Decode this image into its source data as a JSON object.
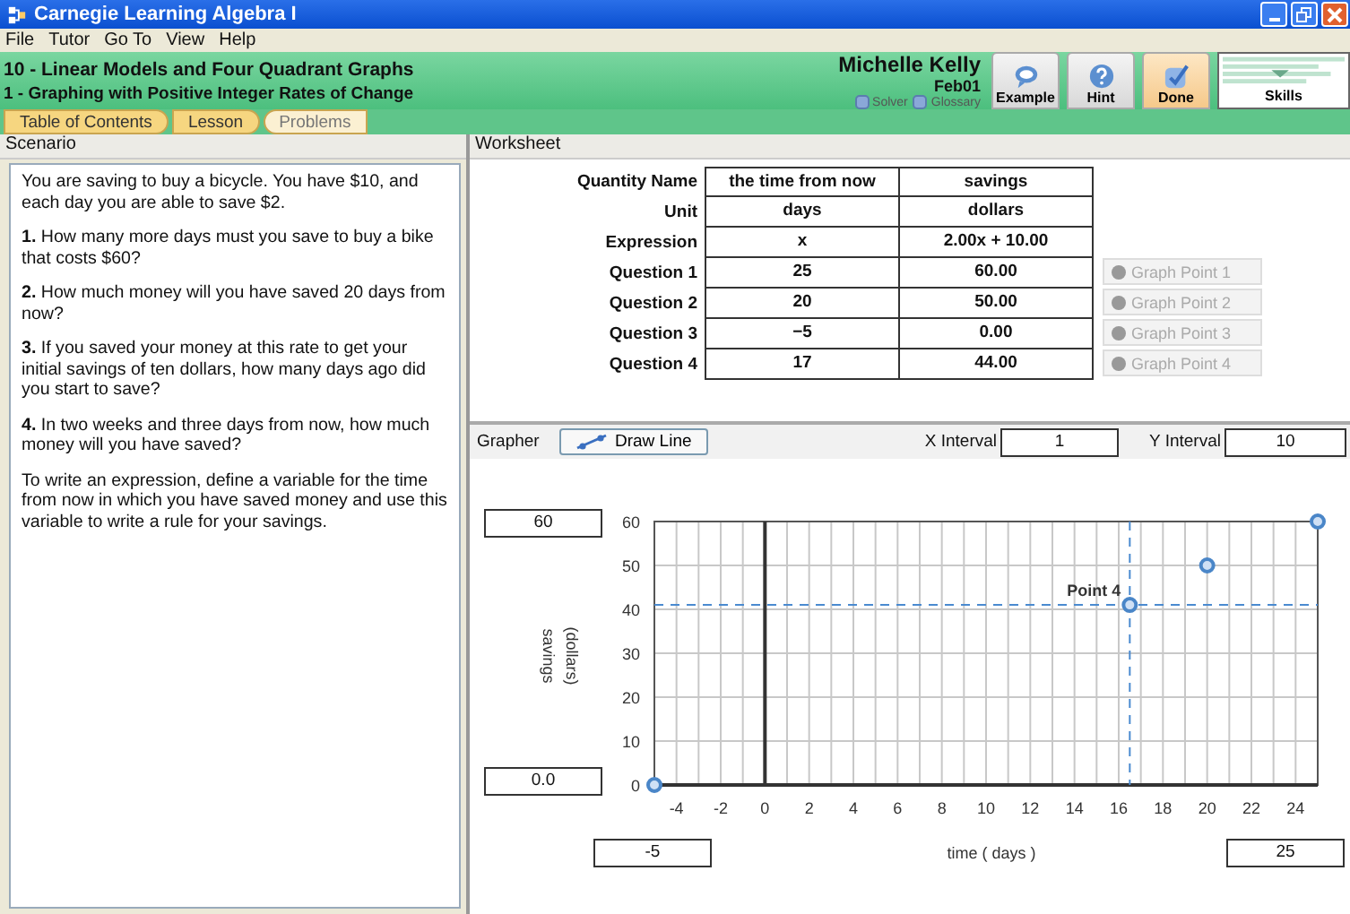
{
  "window": {
    "title": "Carnegie Learning Algebra I"
  },
  "menu": [
    "File",
    "Tutor",
    "Go To",
    "View",
    "Help"
  ],
  "header": {
    "unit": "10 - Linear Models and Four Quadrant Graphs",
    "section": "1 - Graphing with Positive Integer Rates of Change",
    "student": "Michelle Kelly",
    "class": "Feb01",
    "links": [
      "Solver",
      "Glossary"
    ],
    "buttons": [
      {
        "label": "Example",
        "kind": "example"
      },
      {
        "label": "Hint",
        "kind": "hint"
      },
      {
        "label": "Done",
        "kind": "done"
      }
    ],
    "skills": "Skills"
  },
  "tabs": [
    {
      "label": "Table of Contents",
      "selected": false
    },
    {
      "label": "Lesson",
      "selected": false
    },
    {
      "label": "Problems",
      "selected": true
    }
  ],
  "scenario": {
    "title": "Scenario",
    "paragraphs": [
      "You are saving to buy a bicycle. You have $10, and each day you are able to save $2.",
      "**1.** How many more days must you save to buy a bike that costs $60?",
      "**2.** How much money will you have saved 20 days from now?",
      "**3.** If you saved your money at this rate to get your initial savings of ten dollars, how many days ago did you start to save?",
      "**4.** In two weeks and three days from now, how much money will you have saved?",
      "To write an expression, define a variable for the time from now in which you have saved money and use this variable to write a rule for your savings."
    ]
  },
  "worksheet": {
    "title": "Worksheet",
    "rows": [
      {
        "label": "Quantity Name",
        "cells": [
          "the time from now",
          "savings"
        ]
      },
      {
        "label": "Unit",
        "cells": [
          "days",
          "dollars"
        ]
      },
      {
        "label": "Expression",
        "cells": [
          "x",
          "2.00x + 10.00"
        ]
      },
      {
        "label": "Question 1",
        "cells": [
          "25",
          "60.00"
        ],
        "button": {
          "label": "Graph Point 1",
          "disabled": true
        }
      },
      {
        "label": "Question 2",
        "cells": [
          "20",
          "50.00"
        ],
        "button": {
          "label": "Graph Point 2",
          "disabled": true
        }
      },
      {
        "label": "Question 3",
        "cells": [
          "−5",
          "0.00"
        ],
        "button": {
          "label": "Graph Point 3",
          "disabled": true
        }
      },
      {
        "label": "Question 4",
        "cells": [
          "17",
          "44.00"
        ],
        "button": {
          "label": "Graph Point 4",
          "disabled": true
        }
      }
    ]
  },
  "grapher": {
    "title": "Grapher",
    "draw_line": "Draw Line",
    "x_interval": {
      "label": "X Interval",
      "value": "1"
    },
    "y_interval": {
      "label": "Y Interval",
      "value": "10"
    },
    "y_max": "60",
    "y_min": "0.0",
    "x_min": "-5",
    "x_max": "25",
    "y_unit": "(dollars)",
    "chart_data": {
      "type": "scatter",
      "xlabel": "time ( days )",
      "ylabel": "savings",
      "xlim": [
        -5,
        25
      ],
      "ylim": [
        0,
        60
      ],
      "xticks": [
        -4,
        -2,
        0,
        2,
        4,
        6,
        8,
        10,
        12,
        14,
        16,
        18,
        20,
        22,
        24
      ],
      "yticks": [
        0,
        10,
        20,
        30,
        40,
        50,
        60
      ],
      "x": [
        -5,
        20,
        16.5,
        25
      ],
      "series": [
        {
          "color": "#4a86c8",
          "values": [
            0,
            50,
            41,
            60
          ]
        }
      ],
      "grid": true,
      "ref_lines": [
        {
          "axis": "x",
          "value": 16.5,
          "color": "#4a8ad0"
        },
        {
          "axis": "y",
          "value": 41,
          "color": "#4a8ad0"
        }
      ],
      "annotations": [
        {
          "x": 16.5,
          "y": 41,
          "text": "Point 4"
        }
      ]
    }
  }
}
